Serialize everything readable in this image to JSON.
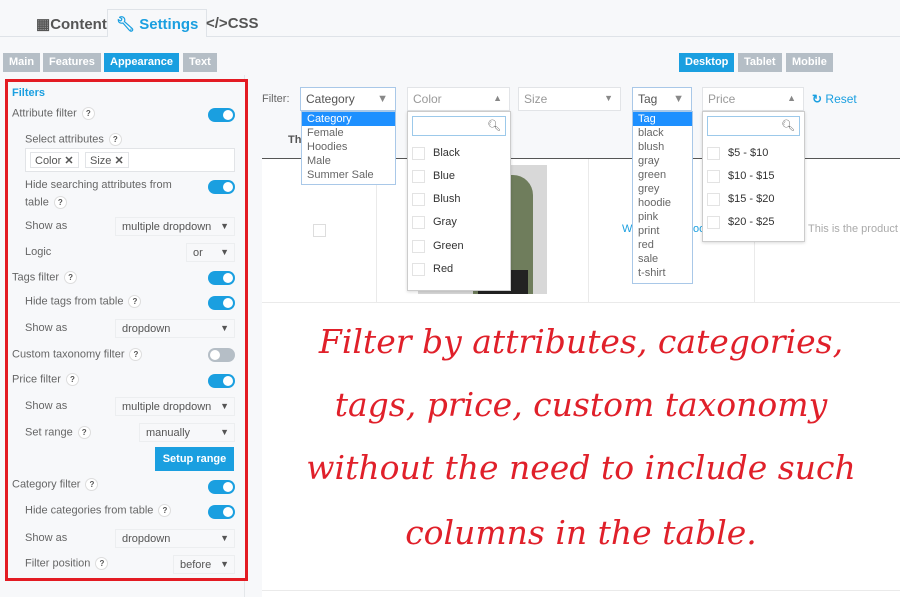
{
  "top_tabs": [
    {
      "label": "Content",
      "icon": "grid-icon"
    },
    {
      "label": "Settings",
      "icon": "wrench-icon",
      "active": true
    },
    {
      "label": "CSS",
      "icon": "code-icon"
    }
  ],
  "sub_tabs": [
    {
      "label": "Main"
    },
    {
      "label": "Features"
    },
    {
      "label": "Appearance",
      "active": true
    },
    {
      "label": "Text"
    }
  ],
  "device_tabs": [
    {
      "label": "Desktop",
      "active": true
    },
    {
      "label": "Tablet"
    },
    {
      "label": "Mobile"
    }
  ],
  "accent_color": "#1a9fe0",
  "highlight_border_color": "#e31b23",
  "sidebar": {
    "section_title": "Filters",
    "attribute_filter": {
      "label": "Attribute filter",
      "on": true
    },
    "select_attributes": {
      "label": "Select attributes",
      "tags": [
        "Color",
        "Size"
      ]
    },
    "hide_searching": {
      "label": "Hide searching attributes from",
      "label2": "table",
      "on": true
    },
    "attr_show_as": {
      "label": "Show as",
      "value": "multiple dropdown"
    },
    "logic": {
      "label": "Logic",
      "value": "or"
    },
    "tags_filter": {
      "label": "Tags filter",
      "on": true
    },
    "hide_tags": {
      "label": "Hide tags from table",
      "on": true
    },
    "tags_show_as": {
      "label": "Show as",
      "value": "dropdown"
    },
    "custom_taxonomy": {
      "label": "Custom taxonomy filter",
      "on": false
    },
    "price_filter": {
      "label": "Price filter",
      "on": true
    },
    "price_show_as": {
      "label": "Show as",
      "value": "multiple dropdown"
    },
    "set_range": {
      "label": "Set range",
      "value": "manually"
    },
    "setup_range_button": "Setup range",
    "category_filter": {
      "label": "Category filter",
      "on": true
    },
    "hide_categories": {
      "label": "Hide categories from table",
      "on": true
    },
    "cat_show_as": {
      "label": "Show as",
      "value": "dropdown"
    },
    "filter_position": {
      "label": "Filter position",
      "value": "before"
    }
  },
  "filter_bar": {
    "label": "Filter:",
    "category": {
      "value": "Category",
      "options": [
        "Category",
        "Female",
        "Hoodies",
        "Male",
        "Summer Sale"
      ]
    },
    "color": {
      "placeholder": "Color",
      "options": [
        "Black",
        "Blue",
        "Blush",
        "Gray",
        "Green",
        "Red"
      ]
    },
    "size": {
      "placeholder": "Size"
    },
    "tag": {
      "value": "Tag",
      "options": [
        "Tag",
        "black",
        "blush",
        "gray",
        "green",
        "grey",
        "hoodie",
        "pink",
        "print",
        "red",
        "sale",
        "t-shirt"
      ]
    },
    "price": {
      "placeholder": "Price",
      "options": [
        "$5 - $10",
        "$10 - $15",
        "$15 - $20",
        "$20 - $25"
      ]
    },
    "reset": "Reset"
  },
  "table": {
    "header_partial": "Th",
    "link_partial_1": "W",
    "link_partial_2": "oo",
    "description": "This is the product"
  },
  "overlay_text": [
    "Filter by attributes, categories,",
    "tags, price, custom taxonomy",
    "without the need to include such",
    "columns in the table."
  ]
}
